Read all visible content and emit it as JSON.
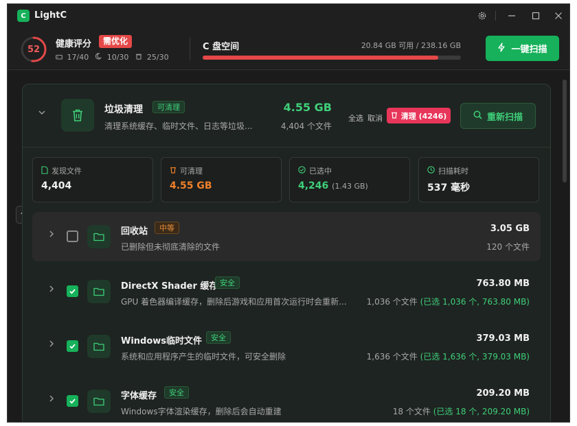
{
  "app": {
    "logo_glyph": "C",
    "title": "LightC"
  },
  "header": {
    "health_score": "52",
    "health_fraction": 0.52,
    "health_title": "健康评分",
    "health_badge": "需优化",
    "stat_1": "17/40",
    "stat_2": "10/30",
    "stat_3": "25/30",
    "disk_title": "C 盘空间",
    "disk_info": "20.84 GB 可用 / 238.16 GB",
    "disk_used_fraction": 0.913,
    "scan_button": "一键扫描"
  },
  "category": {
    "title": "垃圾清理",
    "tag": "可清理",
    "desc": "清理系统缓存、临时文件、日志等垃圾...",
    "size": "4.55 GB",
    "count": "4,404 个文件",
    "select_all": "全选",
    "cancel": "取消",
    "clean_button": "清理 (4246)",
    "rescan_button": "重新扫描"
  },
  "stats": [
    {
      "label": "发现文件",
      "value": "4,404",
      "sub": "",
      "color": "#f0f0f0",
      "icon": "file-icon"
    },
    {
      "label": "可清理",
      "value": "4.55 GB",
      "sub": "",
      "color": "#f0802a",
      "icon": "trash-icon"
    },
    {
      "label": "已选中",
      "value": "4,246",
      "sub": "(1.43 GB)",
      "color": "#3fcf7a",
      "icon": "check-circle-icon"
    },
    {
      "label": "扫描耗时",
      "value": "537 毫秒",
      "sub": "",
      "color": "#f0f0f0",
      "icon": "clock-icon"
    }
  ],
  "items": [
    {
      "title": "回收站",
      "tag": "中等",
      "tag_style": "orange",
      "desc": "已删除但未彻底清除的文件",
      "size": "3.05 GB",
      "count": "120 个文件",
      "selected_text": "",
      "checked": false
    },
    {
      "title": "DirectX Shader 缓存",
      "tag": "安全",
      "tag_style": "green",
      "desc": "GPU 着色器编译缓存，删除后游戏和应用首次运行时会重新...",
      "size": "763.80 MB",
      "count": "1,036 个文件",
      "selected_text": "(已选 1,036 个, 763.80 MB)",
      "checked": true
    },
    {
      "title": "Windows临时文件",
      "tag": "安全",
      "tag_style": "green",
      "desc": "系统和应用程序产生的临时文件，可安全删除",
      "size": "379.03 MB",
      "count": "1,636 个文件",
      "selected_text": "(已选 1,636 个, 379.03 MB)",
      "checked": true
    },
    {
      "title": "字体缓存",
      "tag": "安全",
      "tag_style": "green",
      "desc": "Windows字体渲染缓存，删除后会自动重建",
      "size": "209.20 MB",
      "count": "18 个文件",
      "selected_text": "(已选 18 个, 209.20 MB)",
      "checked": true
    }
  ],
  "colors": {
    "accent": "#16b15a",
    "danger": "#e54848",
    "clean": "#e8365a",
    "warning": "#f0802a"
  }
}
